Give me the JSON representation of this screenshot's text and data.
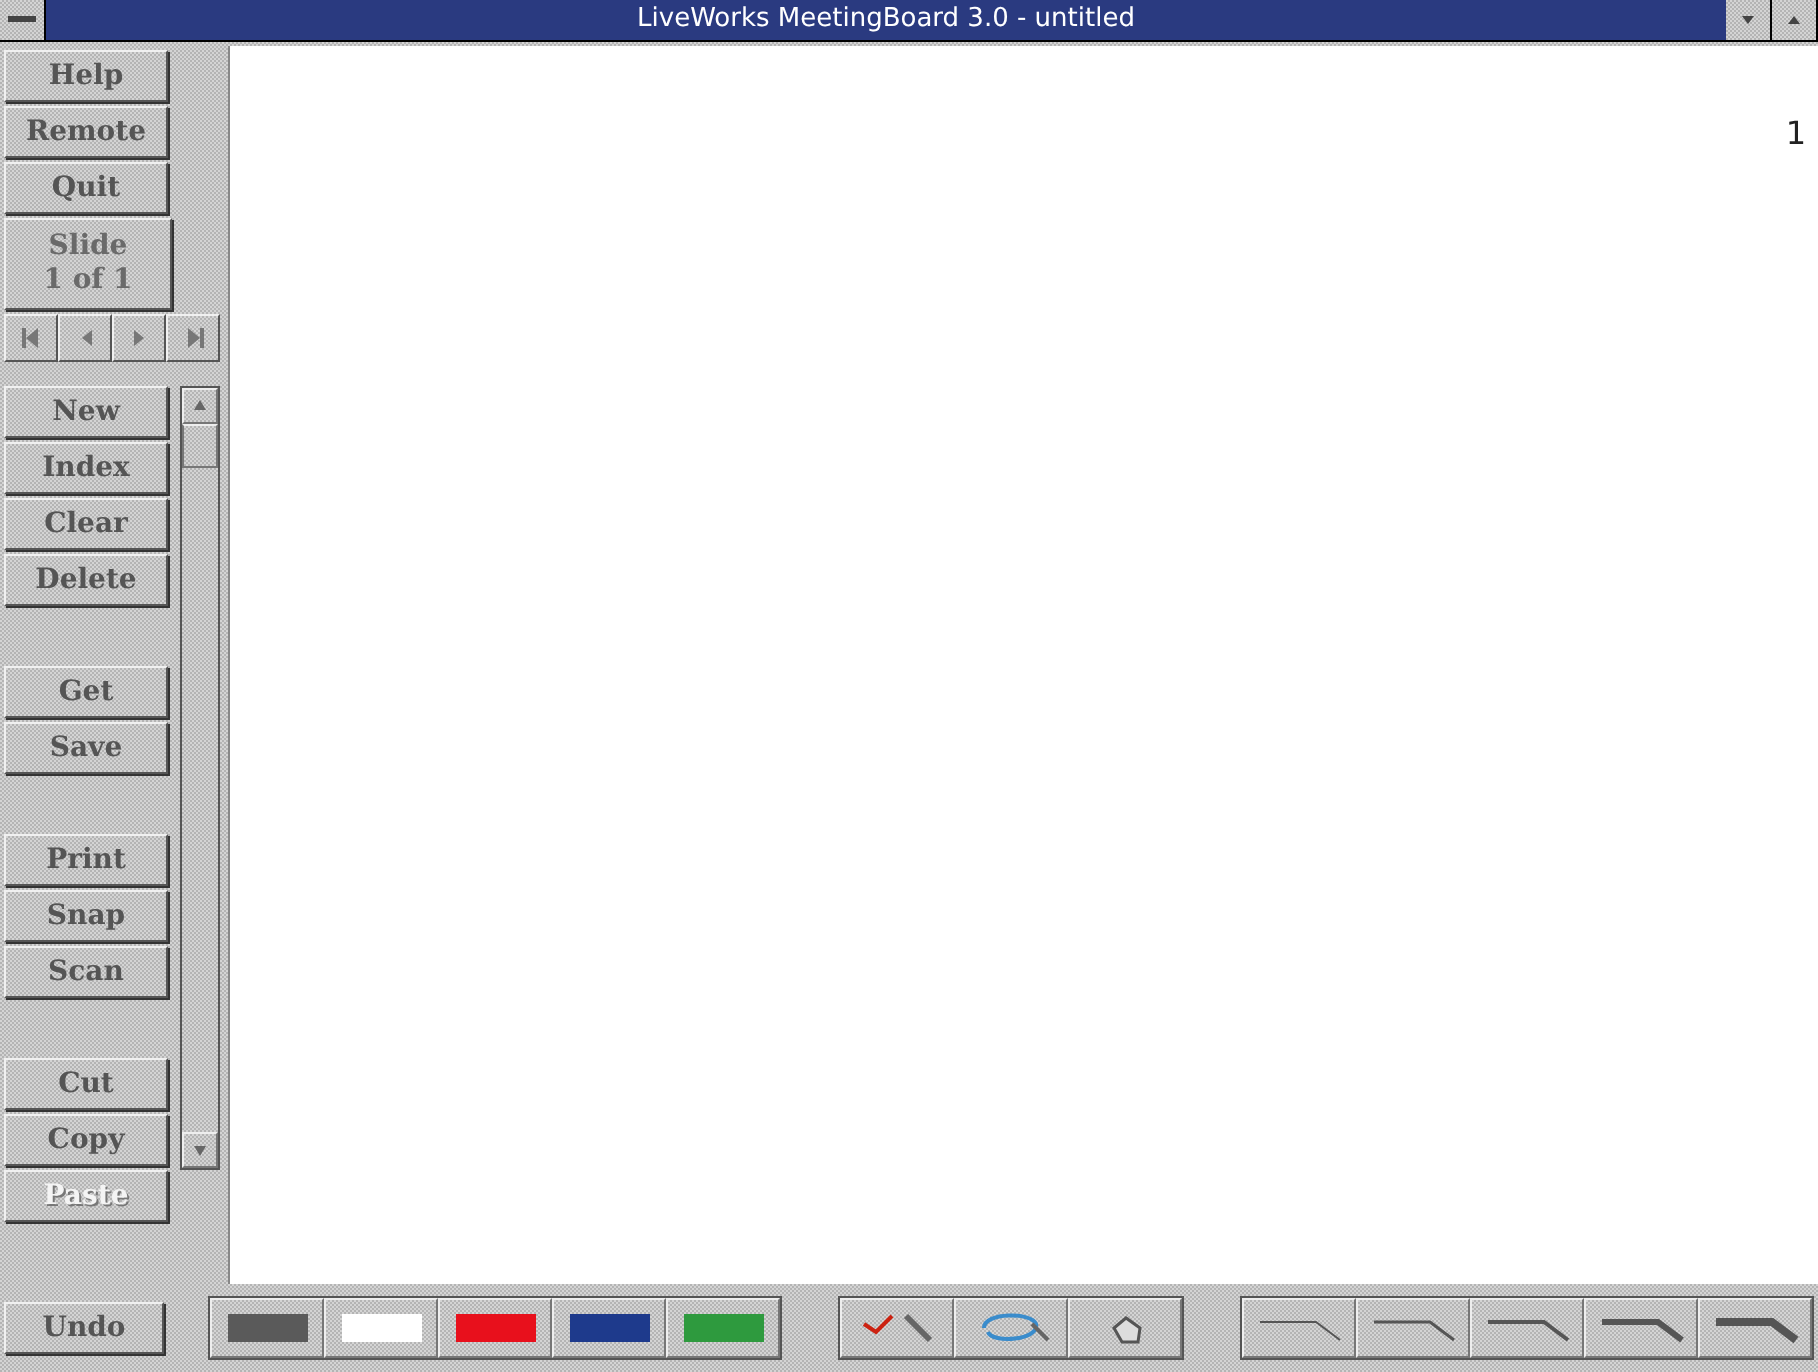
{
  "window": {
    "title": "LiveWorks MeetingBoard 3.0 - untitled"
  },
  "top_buttons": [
    {
      "label": "Help",
      "disabled": false
    },
    {
      "label": "Remote",
      "disabled": false
    },
    {
      "label": "Quit",
      "disabled": false
    }
  ],
  "slide": {
    "label": "Slide",
    "position": "1 of 1"
  },
  "button_groups": [
    [
      {
        "label": "New",
        "disabled": false
      },
      {
        "label": "Index",
        "disabled": false
      },
      {
        "label": "Clear",
        "disabled": false
      },
      {
        "label": "Delete",
        "disabled": false
      }
    ],
    [
      {
        "label": "Get",
        "disabled": false
      },
      {
        "label": "Save",
        "disabled": false
      }
    ],
    [
      {
        "label": "Print",
        "disabled": false
      },
      {
        "label": "Snap",
        "disabled": false
      },
      {
        "label": "Scan",
        "disabled": false
      }
    ],
    [
      {
        "label": "Cut",
        "disabled": false
      },
      {
        "label": "Copy",
        "disabled": false
      },
      {
        "label": "Paste",
        "disabled": true
      }
    ]
  ],
  "page_number": "1",
  "undo": {
    "label": "Undo",
    "disabled": false
  },
  "colors": [
    {
      "color": "#5a5a5a"
    },
    {
      "color": "#ffffff"
    },
    {
      "color": "#e8101c"
    },
    {
      "color": "#1e3a8c"
    },
    {
      "color": "#2e9a3e"
    }
  ],
  "tools": [
    {
      "kind": "pen"
    },
    {
      "kind": "lasso"
    },
    {
      "kind": "eraser"
    }
  ],
  "line_widths": [
    {
      "kind": "thin"
    },
    {
      "kind": "light"
    },
    {
      "kind": "medium"
    },
    {
      "kind": "heavy"
    },
    {
      "kind": "thick"
    }
  ]
}
